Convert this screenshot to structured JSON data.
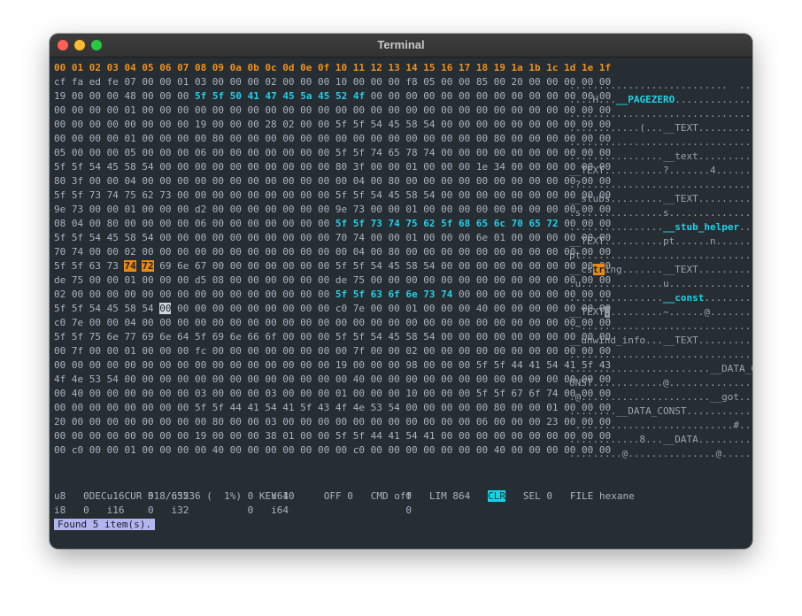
{
  "window": {
    "title": "Terminal"
  },
  "header_bytes": "00 01 02 03 04 05 06 07 08 09 0a 0b 0c 0d 0e 0f 10 11 12 13 14 15 16 17 18 19 1a 1b 1c 1d 1e 1f",
  "rows": [
    {
      "hex": "cf fa ed fe 07 00 00 01 03 00 00 00 02 00 00 00 10 00 00 00 f8 05 00 00 85 00 20 00 00 00 00 00",
      "ascii": "...........................  ....."
    },
    {
      "hex": "19 00 00 00 48 00 00 00 5f 5f 50 41 47 45 5a 45 52 4f 00 00 00 00 00 00 00 00 00 00 00 00 00 00",
      "ascii": "....H...__PAGEZERO.............."
    },
    {
      "hex": "00 00 00 00 01 00 00 00 00 00 00 00 00 00 00 00 00 00 00 00 00 00 00 00 00 00 00 00 00 00 00 00",
      "ascii": "................................"
    },
    {
      "hex": "00 00 00 00 00 00 00 00 19 00 00 00 28 02 00 00 5f 5f 54 45 58 54 00 00 00 00 00 00 00 00 00 00",
      "ascii": "............(...__TEXT.........."
    },
    {
      "hex": "00 00 00 00 01 00 00 00 00 80 00 00 00 00 00 00 00 00 00 00 00 00 00 00 00 80 00 00 00 00 00 00",
      "ascii": "................................"
    },
    {
      "hex": "05 00 00 00 05 00 00 00 06 00 00 00 00 00 00 00 5f 5f 74 65 78 74 00 00 00 00 00 00 00 00 00 00",
      "ascii": "................__text.........."
    },
    {
      "hex": "5f 5f 54 45 58 54 00 00 00 00 00 00 00 00 00 00 80 3f 00 00 01 00 00 00 1e 34 00 00 00 00 00 00",
      "ascii": "__TEXT..........?.......4......."
    },
    {
      "hex": "80 3f 00 00 04 00 00 00 00 00 00 00 00 00 00 00 00 04 00 80 00 00 00 00 00 00 00 00 00 00 00 00",
      "ascii": ".?.............................."
    },
    {
      "hex": "5f 5f 73 74 75 62 73 00 00 00 00 00 00 00 00 00 5f 5f 54 45 58 54 00 00 00 00 00 00 00 00 00 00",
      "ascii": "__stubs.........__TEXT.........."
    },
    {
      "hex": "9e 73 00 00 01 00 00 00 d2 00 00 00 00 00 00 00 9e 73 00 00 01 00 00 00 00 00 00 00 00 00 00 00",
      "ascii": ".s..............s..............."
    },
    {
      "hex": "08 04 00 80 00 00 00 00 06 00 00 00 00 00 00 00 5f 5f 73 74 75 62 5f 68 65 6c 70 65 72 00 00 00",
      "ascii": "................__stub_helper..."
    },
    {
      "hex": "5f 5f 54 45 58 54 00 00 00 00 00 00 00 00 00 00 70 74 00 00 01 00 00 00 6e 01 00 00 00 00 00 00",
      "ascii": "__TEXT..........pt......n......."
    },
    {
      "hex": "70 74 00 00 02 00 00 00 00 00 00 00 00 00 00 00 00 04 00 80 00 00 00 00 00 00 00 00 00 00 00 00",
      "ascii": "pt.............................."
    },
    {
      "hex": "5f 5f 63 73 74 72 69 6e 67 00 00 00 00 00 00 00 5f 5f 54 45 58 54 00 00 00 00 00 00 00 00 00 00",
      "ascii": "__cstring.......__TEXT.........."
    },
    {
      "hex": "de 75 00 00 01 00 00 00 d5 08 00 00 00 00 00 00 de 75 00 00 00 00 00 00 00 00 00 00 00 00 00 00",
      "ascii": ".u..............u..............."
    },
    {
      "hex": "02 00 00 00 00 00 00 00 00 00 00 00 00 00 00 00 5f 5f 63 6f 6e 73 74 00 00 00 00 00 00 00 00 00",
      "ascii": "................__const........."
    },
    {
      "hex": "5f 5f 54 45 58 54 00 00 00 00 00 00 00 00 00 00 c0 7e 00 00 01 00 00 00 40 00 00 00 00 00 00 00",
      "ascii": "__TEXT..........~......@......."
    },
    {
      "hex": "c0 7e 00 00 04 00 00 00 00 00 00 00 00 00 00 00 00 00 00 00 00 00 00 00 00 00 00 00 00 00 00 00",
      "ascii": ".~.............................."
    },
    {
      "hex": "5f 5f 75 6e 77 69 6e 64 5f 69 6e 66 6f 00 00 00 5f 5f 54 45 58 54 00 00 00 00 00 00 00 00 00 00",
      "ascii": "__unwind_info...__TEXT.........."
    },
    {
      "hex": "00 7f 00 00 01 00 00 00 fc 00 00 00 00 00 00 00 00 7f 00 00 02 00 00 00 00 00 00 00 00 00 00 00",
      "ascii": "................................"
    },
    {
      "hex": "00 00 00 00 00 00 00 00 00 00 00 00 00 00 00 00 19 00 00 00 98 00 00 00 5f 5f 44 41 54 41 5f 43",
      "ascii": "........................__DATA_C"
    },
    {
      "hex": "4f 4e 53 54 00 00 00 00 00 00 00 00 00 00 00 00 00 40 00 00 00 00 00 00 00 00 00 00 00 00 00 00",
      "ascii": "ONST............@..............."
    },
    {
      "hex": "00 40 00 00 00 00 00 00 03 00 00 00 03 00 00 00 01 00 00 00 10 00 00 00 5f 5f 67 6f 74 00 00 00",
      "ascii": ".@......................__got..."
    },
    {
      "hex": "00 00 00 00 00 00 00 00 5f 5f 44 41 54 41 5f 43 4f 4e 53 54 00 00 00 00 00 80 00 00 01 00 00 00",
      "ascii": "........__DATA_CONST............"
    },
    {
      "hex": "20 00 00 00 00 00 00 00 00 80 00 00 03 00 00 00 00 00 00 00 00 00 00 00 06 00 00 00 23 00 00 00",
      "ascii": " ...........................#..."
    },
    {
      "hex": "00 00 00 00 00 00 00 00 19 00 00 00 38 01 00 00 5f 5f 44 41 54 41 00 00 00 00 00 00 00 00 00 00",
      "ascii": "............8...__DATA.........."
    },
    {
      "hex": "00 c0 00 00 01 00 00 00 00 40 00 00 00 00 00 00 00 c0 00 00 00 00 00 00 00 40 00 00 00 00 00 00",
      "ascii": ".........@...............@......"
    }
  ],
  "status": {
    "mode": "DEC",
    "cur": "CUR 518/65536 (  1%)",
    "key": "KEY 10",
    "off": "OFF 0",
    "cmd": "CMD off",
    "lim": "LIM 864",
    "clr": "CLR",
    "sel": "SEL 0",
    "file": "FILE hexane"
  },
  "values": {
    "u8": "0",
    "u16": "0",
    "u32": "0",
    "u64": "0",
    "i8": "0",
    "i16": "0",
    "i32": "0",
    "i64": "0"
  },
  "message": "Found 5 item(s).",
  "colors": {
    "header": "#f0901a",
    "match": "#22d0e6",
    "selection": "#ea8a12",
    "clr_badge": "#16d4e8",
    "message_bg": "#b3b6ee",
    "caret": "#c4d600"
  }
}
